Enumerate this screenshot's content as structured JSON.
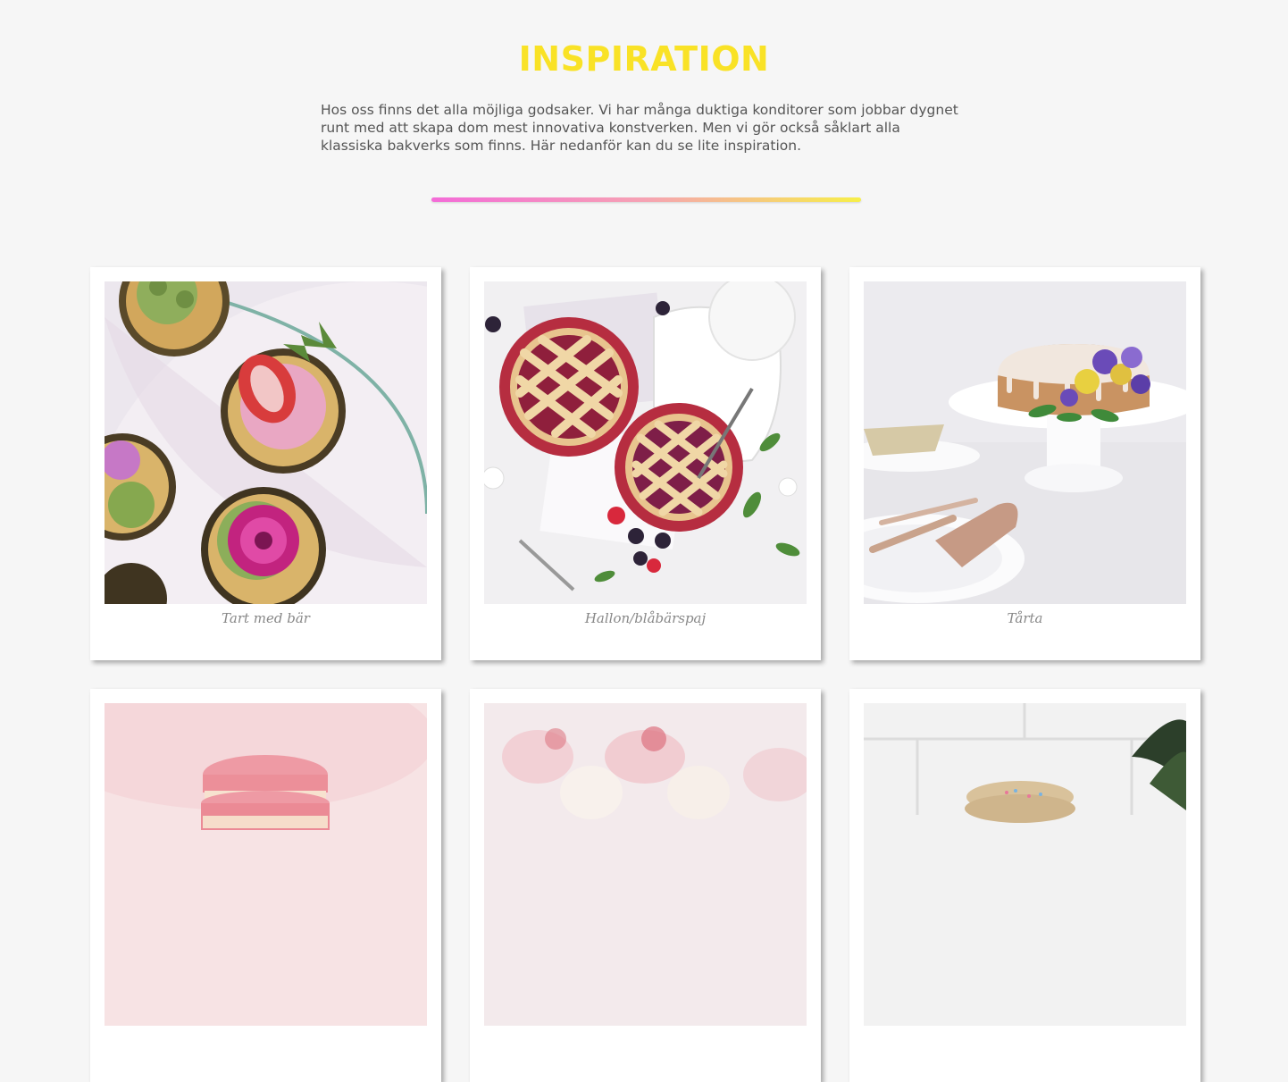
{
  "header": {
    "title": "INSPIRATION",
    "intro": "Hos oss finns det alla möjliga godsaker. Vi har många duktiga konditorer som jobbar dygnet runt med att skapa dom mest innovativa konstverken. Men vi gör också såklart alla klassiska bakverks som finns. Här nedanför kan du se lite inspiration.",
    "divider_colors": [
      "#f46bd8",
      "#f6a3b3",
      "#f7ef48"
    ],
    "title_color": "#f9e226"
  },
  "gallery": {
    "items": [
      {
        "caption": "Tart med bär",
        "photo": "cupcakes-with-strawberry-and-flowers"
      },
      {
        "caption": "Hallon/blåbärspaj",
        "photo": "berry-lattice-pies"
      },
      {
        "caption": "Tårta",
        "photo": "glazed-cake-with-pansies"
      },
      {
        "caption": "",
        "photo": "pink-macarons"
      },
      {
        "caption": "",
        "photo": "cream-cupcakes-with-strawberries"
      },
      {
        "caption": "",
        "photo": "sprinkle-cookies"
      }
    ]
  }
}
